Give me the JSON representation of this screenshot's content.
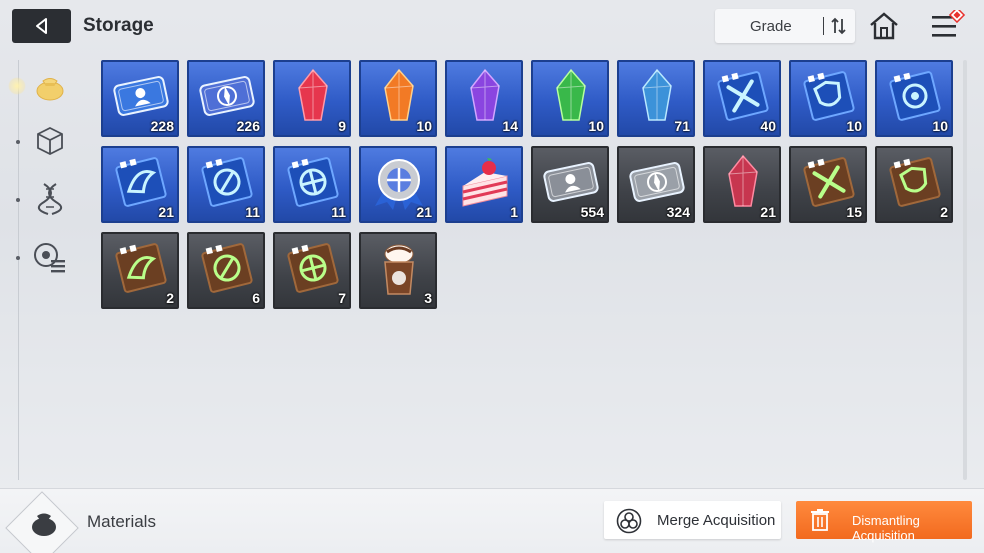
{
  "header": {
    "title": "Storage",
    "sort_label": "Grade"
  },
  "sidebar": {
    "items": [
      {
        "icon": "pouch-icon",
        "active": true
      },
      {
        "icon": "cube-icon",
        "active": false
      },
      {
        "icon": "dna-icon",
        "active": false
      },
      {
        "icon": "badge-list-icon",
        "active": false
      }
    ]
  },
  "inventory": {
    "rows": [
      [
        {
          "name": "ticket-user",
          "frame": "blue",
          "qty": "228"
        },
        {
          "name": "ticket-compass",
          "frame": "blue",
          "qty": "226"
        },
        {
          "name": "crystal-red",
          "frame": "blue",
          "qty": "9"
        },
        {
          "name": "crystal-orange",
          "frame": "blue",
          "qty": "10"
        },
        {
          "name": "crystal-purple",
          "frame": "blue",
          "qty": "14"
        },
        {
          "name": "crystal-green",
          "frame": "blue",
          "qty": "10"
        },
        {
          "name": "crystal-blue",
          "frame": "blue",
          "qty": "71"
        },
        {
          "name": "manual-sword",
          "frame": "blue",
          "qty": "40"
        },
        {
          "name": "manual-shield",
          "frame": "blue",
          "qty": "10"
        },
        {
          "name": "manual-target",
          "frame": "blue",
          "qty": "10"
        }
      ],
      [
        {
          "name": "manual-bird",
          "frame": "blue",
          "qty": "21"
        },
        {
          "name": "manual-compass",
          "frame": "blue",
          "qty": "11"
        },
        {
          "name": "manual-cross",
          "frame": "blue",
          "qty": "11"
        },
        {
          "name": "medal-badge",
          "frame": "blue",
          "qty": "21"
        },
        {
          "name": "strawberry-cake",
          "frame": "blue",
          "qty": "1"
        },
        {
          "name": "ticket-user-silver",
          "frame": "gray",
          "qty": "554"
        },
        {
          "name": "ticket-compass-silver",
          "frame": "gray",
          "qty": "324"
        },
        {
          "name": "crystal-pink",
          "frame": "gray",
          "qty": "21"
        },
        {
          "name": "manual-sword-bronze",
          "frame": "gray",
          "qty": "15"
        },
        {
          "name": "manual-shield-bronze",
          "frame": "gray",
          "qty": "2"
        }
      ],
      [
        {
          "name": "manual-bird-bronze",
          "frame": "gray",
          "qty": "2"
        },
        {
          "name": "manual-compass-bronze",
          "frame": "gray",
          "qty": "6"
        },
        {
          "name": "manual-cross-bronze",
          "frame": "gray",
          "qty": "7"
        },
        {
          "name": "chocolate-frappe",
          "frame": "gray",
          "qty": "3"
        }
      ]
    ]
  },
  "footer": {
    "category_label": "Materials",
    "merge_label": "Merge Acquisition",
    "dismantle_label": "Dismantling Acquisition"
  },
  "colors": {
    "blue_frame": "#2f5bc6",
    "gray_frame": "#3f4248",
    "accent_orange": "#f26a1f",
    "notification_red": "#e8322e"
  }
}
